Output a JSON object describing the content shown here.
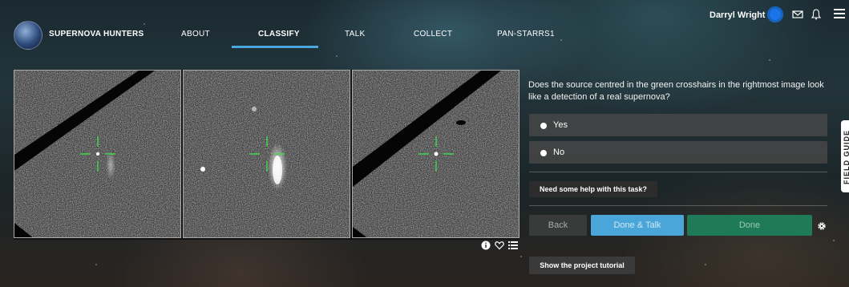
{
  "nav": {
    "brand": "SUPERNOVA HUNTERS",
    "links": [
      "ABOUT",
      "CLASSIFY",
      "TALK",
      "COLLECT",
      "PAN-STARRS1"
    ],
    "user_name": "Darryl Wright",
    "icons": [
      "mail-icon",
      "bell-icon",
      "menu-icon"
    ],
    "accent_color": "#4aa8e0"
  },
  "subject": {
    "panels": [
      "template-image",
      "difference-source-image",
      "target-image"
    ],
    "icons": [
      "info-icon",
      "heart-icon",
      "collections-icon"
    ]
  },
  "task": {
    "question": "Does the source centred in the green crosshairs in the rightmost image look like a detection of a real supernova?",
    "answers": [
      "Yes",
      "No"
    ],
    "help_label": "Need some help with this task?",
    "back_label": "Back",
    "done_talk_label": "Done & Talk",
    "done_label": "Done",
    "tutorial_label": "Show the project tutorial"
  },
  "field_guide": {
    "label": "FIELD GUIDE"
  },
  "colors": {
    "done_talk": "#4aa6d8",
    "done": "#1f7a5a",
    "crosshair": "#3fd64a"
  }
}
